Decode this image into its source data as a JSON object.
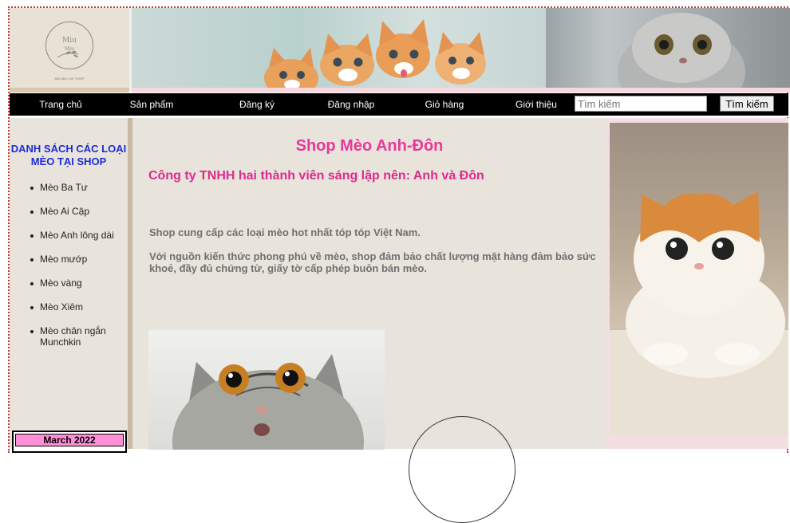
{
  "header": {
    "logo_name": "Miu",
    "logo_sub": "Miu",
    "logo_tagline": "MIU MIU CAT SHOP"
  },
  "nav": {
    "items": [
      "Trang chủ",
      "Sản phẩm",
      "Đăng ký",
      "Đăng nhập",
      "Giỏ hàng",
      "Giới thiệu"
    ],
    "search_placeholder": "Tìm kiếm",
    "search_button": "Tìm kiếm"
  },
  "sidebar": {
    "title": "DANH SÁCH CÁC LOẠI MÈO TẠI SHOP",
    "categories": [
      "Mèo Ba Tư",
      "Mèo Ai Cập",
      "Mèo Anh lông dài",
      "Mèo mướp",
      "Mèo vàng",
      "Mèo Xiêm",
      "Mèo chân ngắn Munchkin"
    ],
    "calendar_month": "March 2022"
  },
  "main": {
    "title": "Shop Mèo Anh-Đôn",
    "company": "Công ty TNHH hai thành viên sáng lập nên: Anh và Đôn",
    "paragraph1": "Shop cung cấp các loại mèo hot nhất tóp tóp Việt Nam.",
    "paragraph2": "Với nguồn kiến thức phong phú về mèo, shop đảm bảo chất lượng mặt hàng đảm bảo sức khoẻ, đầy đủ chứng từ, giấy tờ cấp phép buôn bán mèo."
  },
  "colors": {
    "nav_bg": "#000000",
    "sidebar_title": "#1f2bd8",
    "shop_title": "#e8389a",
    "company": "#e0298f",
    "body_text": "#707070",
    "calendar_head": "#ff8fd8"
  }
}
